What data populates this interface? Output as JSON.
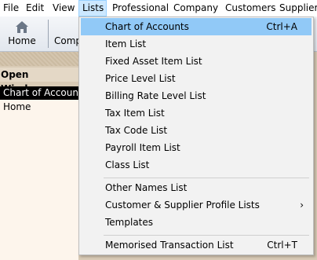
{
  "menubar": {
    "items": [
      "File",
      "Edit",
      "View",
      "Lists",
      "Professional",
      "Company",
      "Customers",
      "Supplier"
    ]
  },
  "toolbar": {
    "home_label": "Home",
    "company_label": "Comp",
    "home_icon": "home-icon"
  },
  "open_windows": {
    "title": "Open Windows",
    "items": [
      "Chart of Accounts",
      "Home"
    ]
  },
  "lists_menu": {
    "items": [
      {
        "label": "Chart of Accounts",
        "shortcut": "Ctrl+A"
      },
      {
        "label": "Item List"
      },
      {
        "label": "Fixed Asset Item List"
      },
      {
        "label": "Price Level List"
      },
      {
        "label": "Billing Rate Level List"
      },
      {
        "label": "Tax Item List"
      },
      {
        "label": "Tax Code List"
      },
      {
        "label": "Payroll Item List"
      },
      {
        "label": "Class List"
      },
      {
        "label": "Other Names List"
      },
      {
        "label": "Customer & Supplier Profile Lists",
        "submenu_arrow": "›"
      },
      {
        "label": "Templates"
      },
      {
        "label": "Memorised Transaction List",
        "shortcut": "Ctrl+T"
      }
    ]
  },
  "colors": {
    "menu_hover": "#91c9f7",
    "menubar_active": "#cce8ff",
    "selected_window": "#000000",
    "background": "#d9cbb6"
  }
}
